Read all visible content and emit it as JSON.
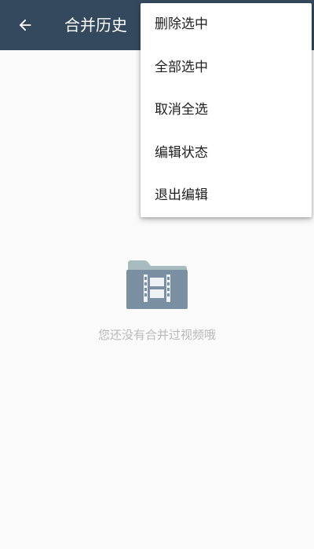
{
  "app_bar": {
    "title": "合并历史",
    "back_icon": "arrow-left-icon",
    "background_color": "#34495e"
  },
  "menu": {
    "items": [
      {
        "label": "删除选中"
      },
      {
        "label": "全部选中"
      },
      {
        "label": "取消全选"
      },
      {
        "label": "编辑状态"
      },
      {
        "label": "退出编辑"
      }
    ]
  },
  "empty_state": {
    "icon": "video-folder-icon",
    "message": "您还没有合并过视频哦",
    "icon_color": "#7a8fa1"
  }
}
